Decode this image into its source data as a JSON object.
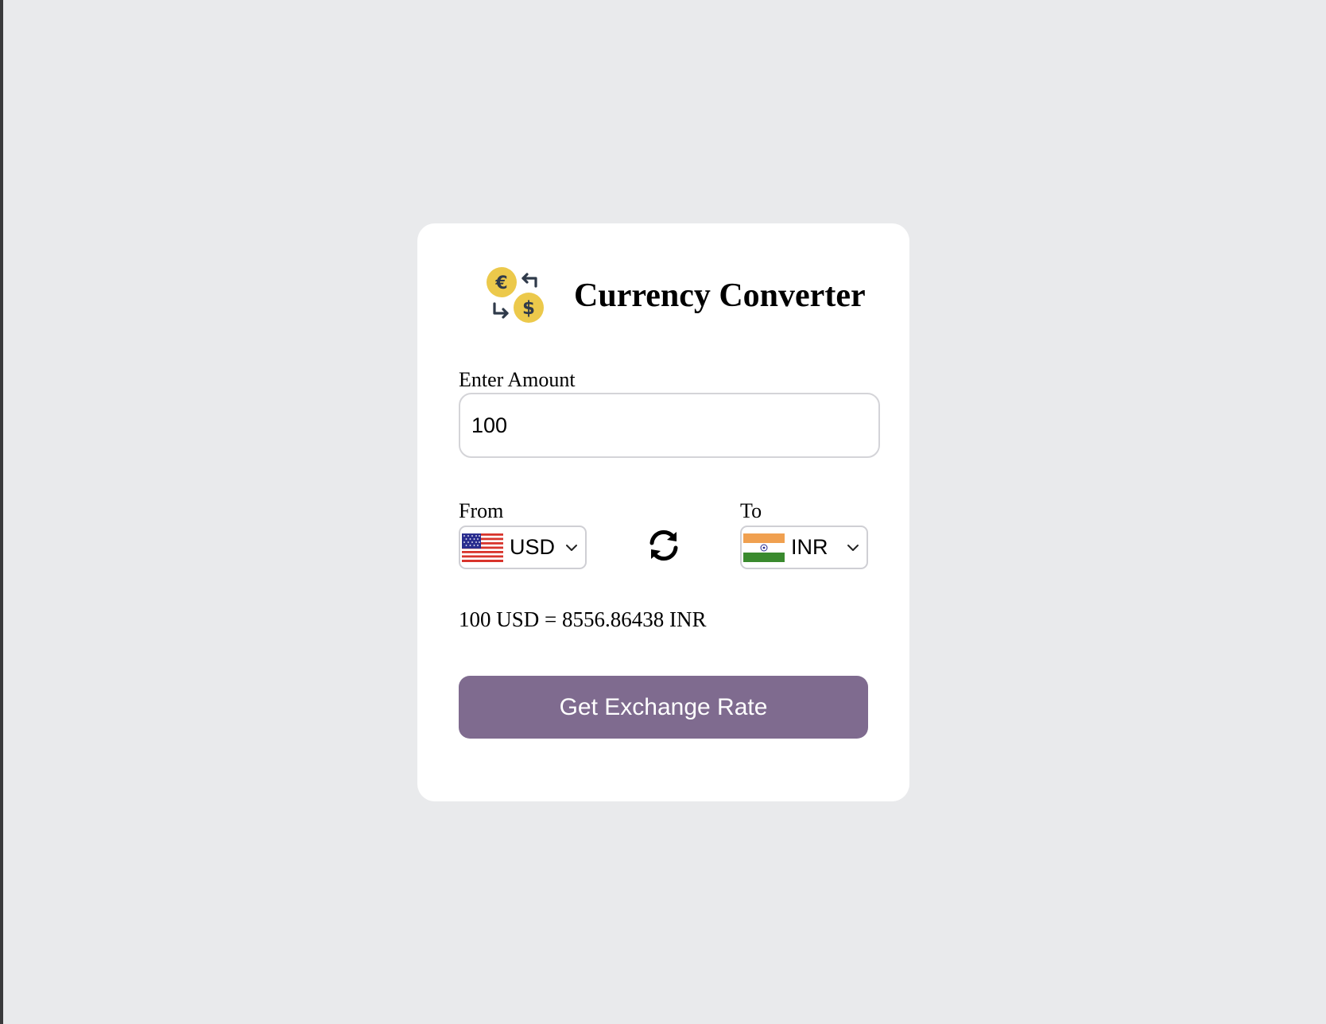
{
  "app": {
    "title": "Currency Converter",
    "logo_icon": "currency-exchange-icon"
  },
  "amount": {
    "label": "Enter Amount",
    "value": "100"
  },
  "from": {
    "label": "From",
    "currency": "USD",
    "flag_icon": "us-flag-icon"
  },
  "to": {
    "label": "To",
    "currency": "INR",
    "flag_icon": "india-flag-icon"
  },
  "swap_icon": "swap-arrows-icon",
  "result": {
    "text": "100 USD = 8556.86438 INR"
  },
  "action": {
    "label": "Get Exchange Rate"
  },
  "colors": {
    "background": "#e9eaec",
    "card": "#ffffff",
    "button": "#7f6b8f",
    "coin": "#ecc94b"
  }
}
